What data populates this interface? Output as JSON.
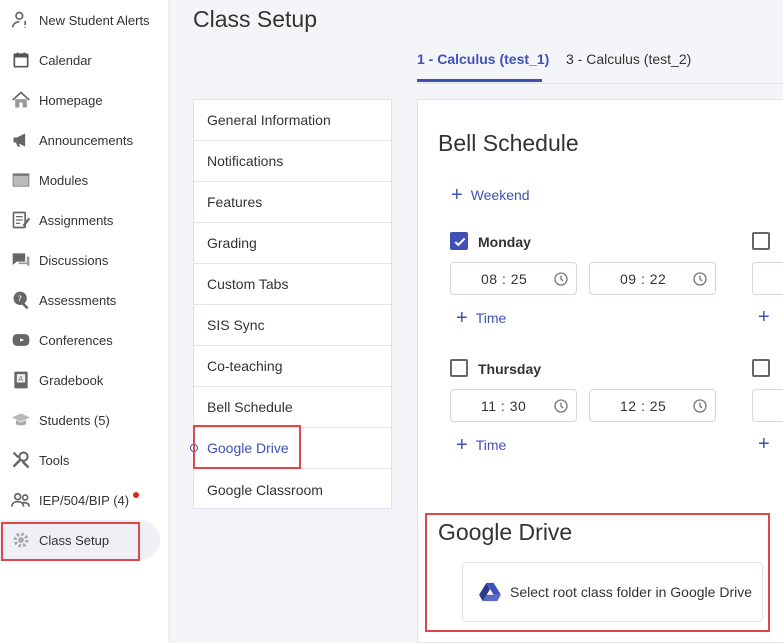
{
  "sidebar": {
    "items": [
      {
        "label": "New Student Alerts",
        "icon": "person-alert-icon"
      },
      {
        "label": "Calendar",
        "icon": "calendar-icon"
      },
      {
        "label": "Homepage",
        "icon": "home-icon"
      },
      {
        "label": "Announcements",
        "icon": "megaphone-icon"
      },
      {
        "label": "Modules",
        "icon": "folder-icon"
      },
      {
        "label": "Assignments",
        "icon": "assignment-icon"
      },
      {
        "label": "Discussions",
        "icon": "chat-icon"
      },
      {
        "label": "Assessments",
        "icon": "assessment-icon"
      },
      {
        "label": "Conferences",
        "icon": "video-icon"
      },
      {
        "label": "Gradebook",
        "icon": "gradebook-icon"
      },
      {
        "label": "Students (5)",
        "icon": "students-icon"
      },
      {
        "label": "Tools",
        "icon": "tools-icon"
      },
      {
        "label": "IEP/504/BIP (4)",
        "icon": "group-icon"
      },
      {
        "label": "Class Setup",
        "icon": "gear-icon"
      }
    ]
  },
  "page": {
    "title": "Class Setup"
  },
  "tabs": [
    {
      "label": "1 - Calculus (test_1)"
    },
    {
      "label": "3 - Calculus (test_2)"
    }
  ],
  "settings_menu": [
    {
      "label": "General Information"
    },
    {
      "label": "Notifications"
    },
    {
      "label": "Features"
    },
    {
      "label": "Grading"
    },
    {
      "label": "Custom Tabs"
    },
    {
      "label": "SIS Sync"
    },
    {
      "label": "Co-teaching"
    },
    {
      "label": "Bell Schedule"
    },
    {
      "label": "Google Drive"
    },
    {
      "label": "Google Classroom"
    }
  ],
  "bell_schedule": {
    "title": "Bell Schedule",
    "weekend_label": "Weekend",
    "add_time_label": "Time",
    "days": [
      {
        "name": "Monday",
        "checked": true,
        "start": "08 : 25",
        "end": "09 : 22"
      },
      {
        "name": "Thursday",
        "checked": false,
        "start": "11 : 30",
        "end": "12 : 25"
      }
    ]
  },
  "google_drive": {
    "title": "Google Drive",
    "button_label": "Select root class folder in Google Drive"
  },
  "colors": {
    "accent": "#3f51b5",
    "highlight_box": "#e04848",
    "notification_dot": "#e0261b"
  }
}
